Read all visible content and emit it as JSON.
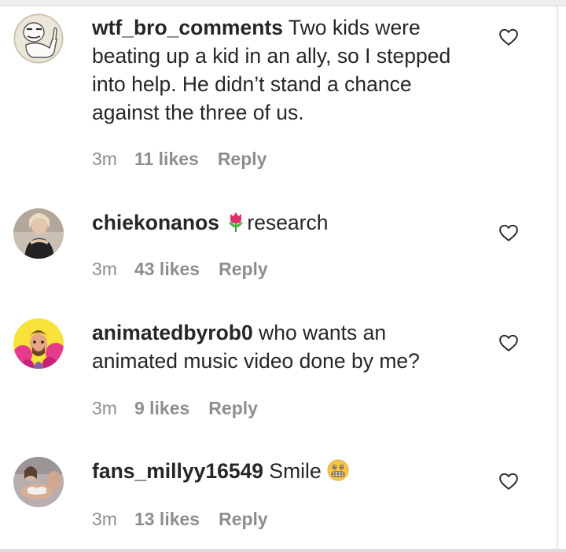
{
  "comments": [
    {
      "username": "wtf_bro_comments",
      "lines": [
        "Two kids were",
        "beating up a kid in an ally, so I stepped",
        "into help. He didn’t stand a chance",
        "against the three of us."
      ],
      "time": "3m",
      "likes": "11 likes",
      "reply": "Reply",
      "avatar_icon": "meme-face-avatar"
    },
    {
      "username": "chiekonanos",
      "emoji": "tulip-emoji",
      "text": "research",
      "time": "3m",
      "likes": "43 likes",
      "reply": "Reply",
      "avatar_icon": "profile-photo-avatar"
    },
    {
      "username": "animatedbyrob0",
      "lines": [
        "who wants an",
        "animated music video done by me?"
      ],
      "time": "3m",
      "likes": "9 likes",
      "reply": "Reply",
      "avatar_icon": "cartoon-avatar"
    },
    {
      "username": "fans_millyy16549",
      "text": "Smile",
      "emoji": "grimacing-face-emoji",
      "time": "3m",
      "likes": "13 likes",
      "reply": "Reply",
      "avatar_icon": "profile-photo-avatar"
    }
  ],
  "colors": {
    "text": "#262626",
    "meta": "#8e8e8e",
    "background": "#ffffff"
  }
}
